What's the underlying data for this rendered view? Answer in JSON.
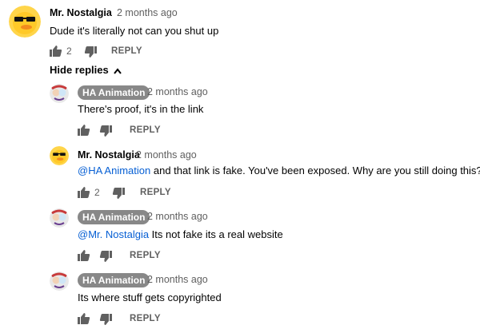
{
  "comments": [
    {
      "author": "Mr. Nostalgia",
      "time": "2 months ago",
      "mention": "",
      "text": "Dude it's literally not can you shut up",
      "likes": "2",
      "reply_label": "REPLY",
      "avatar": "sunglasses-duck"
    }
  ],
  "hide_replies_label": "Hide replies",
  "replies": [
    {
      "author": "HA Animation",
      "time": "2 months ago",
      "mention": "",
      "text": "There's proof, it's in the link",
      "likes": "",
      "reply_label": "REPLY",
      "avatar": "ha-animation"
    },
    {
      "author": "Mr. Nostalgia",
      "time": "2 months ago",
      "mention": "@HA Animation",
      "text": " and that link is fake. You've been exposed. Why are you still doing this???",
      "likes": "2",
      "reply_label": "REPLY",
      "avatar": "sunglasses-duck"
    },
    {
      "author": "HA Animation",
      "time": "2 months ago",
      "mention": "@Mr. Nostalgia",
      "text": " Its not fake its a real website",
      "likes": "",
      "reply_label": "REPLY",
      "avatar": "ha-animation"
    },
    {
      "author": "HA Animation",
      "time": "2 months ago",
      "mention": "",
      "text": "Its where stuff gets copyrighted",
      "likes": "",
      "reply_label": "REPLY",
      "avatar": "ha-animation"
    }
  ],
  "colors": {
    "link": "#065fd4",
    "chip": "#888888",
    "muted": "#606060"
  }
}
